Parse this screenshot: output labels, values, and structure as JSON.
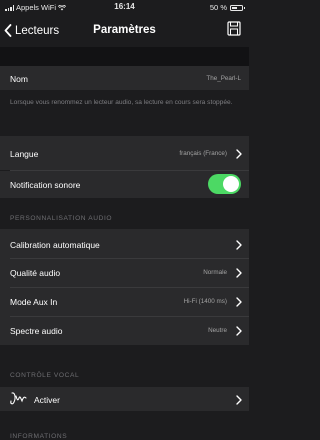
{
  "status": {
    "carrier": "Appels WiFi",
    "time": "16:14",
    "battery": "50 %",
    "battery_level": 0.5
  },
  "nav": {
    "back_label": "Lecteurs",
    "title": "Paramètres"
  },
  "name_row": {
    "label": "Nom",
    "value": "The_Pearl-L"
  },
  "rename_note": "Lorsque vous renommez un lecteur audio, sa lecture en cours sera stoppée.",
  "langue": {
    "label": "Langue",
    "value": "français (France)"
  },
  "notification": {
    "label": "Notification sonore",
    "on": true
  },
  "audio_section": {
    "header": "PERSONNALISATION AUDIO",
    "items": [
      {
        "label": "Calibration automatique",
        "value": ""
      },
      {
        "label": "Qualité audio",
        "value": "Normale"
      },
      {
        "label": "Mode Aux In",
        "value": "Hi-Fi (1400 ms)"
      },
      {
        "label": "Spectre audio",
        "value": "Neutre"
      }
    ]
  },
  "voice_section": {
    "header": "CONTRÔLE VOCAL",
    "activate_label": "Activer"
  },
  "info_section": {
    "header": "INFORMATIONS"
  },
  "colors": {
    "accent_toggle": "#4cd964",
    "background": "#1c1c1e",
    "row": "#2a2a2c"
  }
}
